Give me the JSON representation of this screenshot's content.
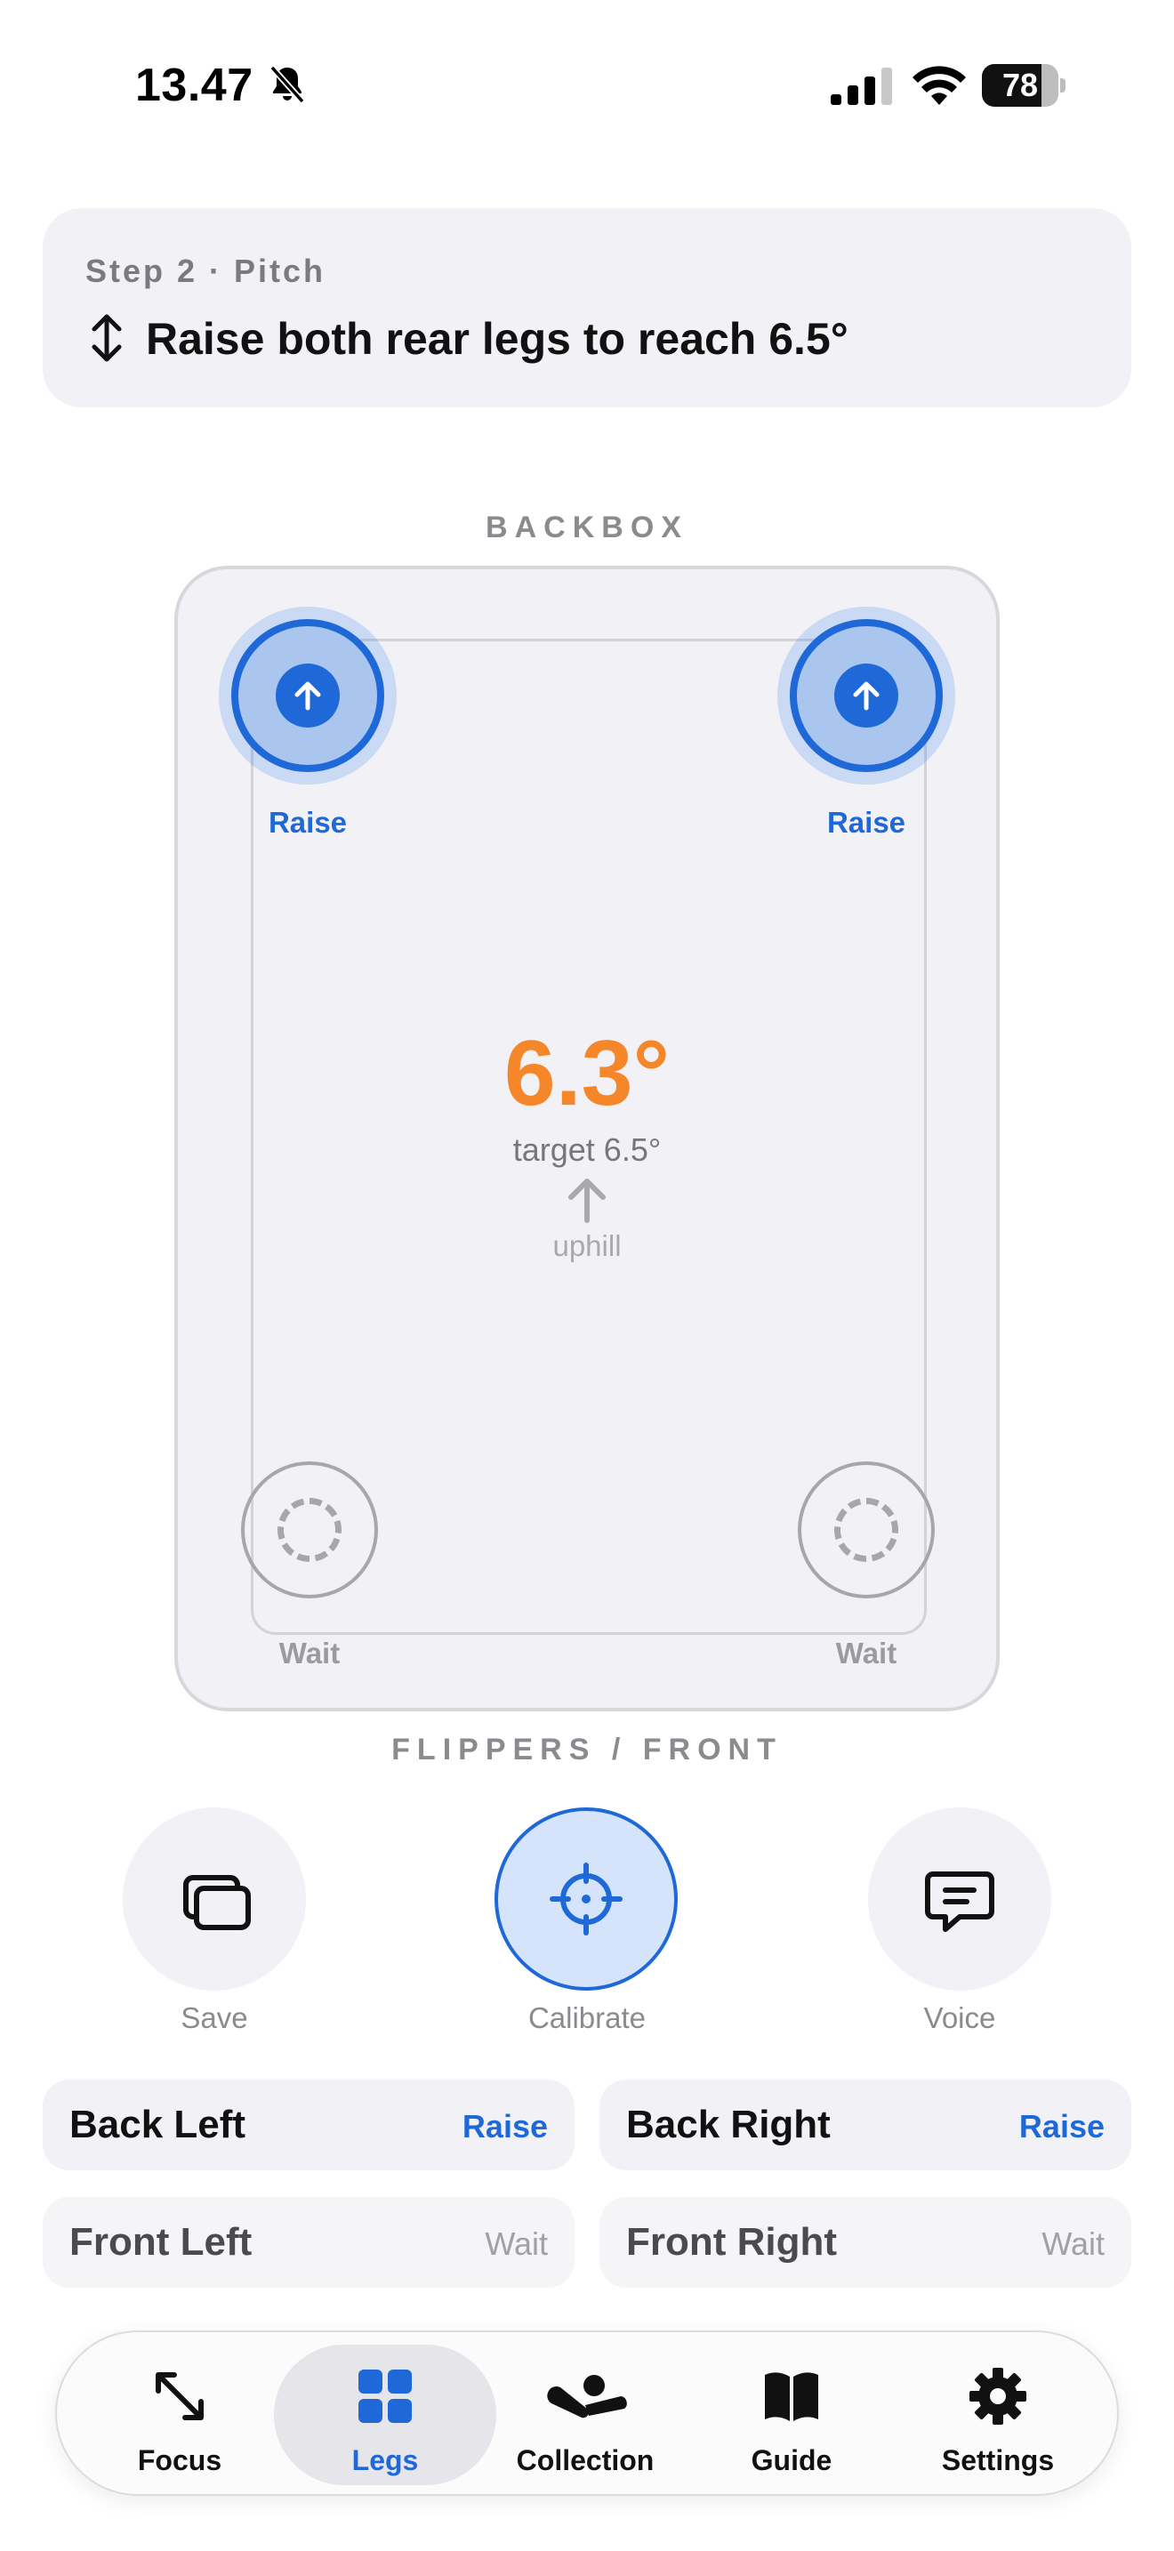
{
  "status_bar": {
    "time": "13.47",
    "battery_percent": "78",
    "battery_level": 0.78
  },
  "instruction": {
    "step": "Step 2 · Pitch",
    "message": "Raise both rear legs to reach 6.5°",
    "icon": "up-down-arrows-icon"
  },
  "board": {
    "top_label": "BACKBOX",
    "bottom_label": "FLIPPERS / FRONT",
    "current_angle": "6.3°",
    "target": "target 6.5°",
    "direction": "uphill",
    "legs": {
      "back_left": "Raise",
      "back_right": "Raise",
      "front_left": "Wait",
      "front_right": "Wait"
    }
  },
  "actions": [
    {
      "label": "Save",
      "icon": "cards-stack-icon"
    },
    {
      "label": "Calibrate",
      "icon": "crosshair-icon"
    },
    {
      "label": "Voice",
      "icon": "speech-bubble-icon"
    }
  ],
  "leg_list": [
    {
      "name": "Back Left",
      "state": "Raise"
    },
    {
      "name": "Back Right",
      "state": "Raise"
    },
    {
      "name": "Front Left",
      "state": "Wait"
    },
    {
      "name": "Front Right",
      "state": "Wait"
    }
  ],
  "tabs": [
    {
      "label": "Focus",
      "icon": "expand-arrows-icon"
    },
    {
      "label": "Legs",
      "icon": "grid-icon",
      "active": true
    },
    {
      "label": "Collection",
      "icon": "flipper-icon"
    },
    {
      "label": "Guide",
      "icon": "book-icon"
    },
    {
      "label": "Settings",
      "icon": "gear-icon"
    }
  ],
  "colors": {
    "accent": "#1e68d8",
    "angle": "#f5862a",
    "card": "#f2f2f6"
  }
}
